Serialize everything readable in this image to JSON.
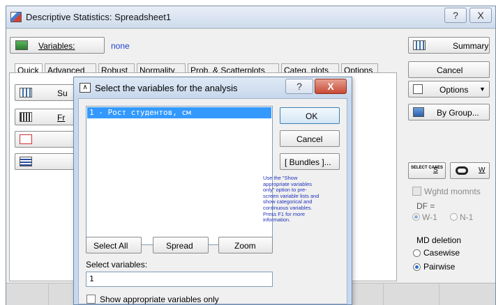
{
  "window": {
    "title": "Descriptive Statistics: Spreadsheet1",
    "help_glyph": "?",
    "close_glyph": "X"
  },
  "variables": {
    "button_label": "Variables:",
    "value": "none"
  },
  "tabs": [
    {
      "label": "Quick"
    },
    {
      "label": "Advanced"
    },
    {
      "label": "Robust"
    },
    {
      "label": "Normality"
    },
    {
      "label": "Prob. & Scatterplots"
    },
    {
      "label": "Categ. plots"
    },
    {
      "label": "Options"
    }
  ],
  "quick_panel": {
    "buttons": [
      {
        "label_partial": "Su"
      },
      {
        "label_partial": "Fr"
      }
    ]
  },
  "right_panel": {
    "summary": "Summary",
    "cancel": "Cancel",
    "options": "Options",
    "by_group": "By Group...",
    "select_cases_icon_text": "SELECT CASES",
    "s_label": "S",
    "w_label": "W",
    "wghtd_momnts": "Wghtd momnts",
    "df_label": "DF =",
    "df_options": [
      "W-1",
      "N-1"
    ],
    "md_deletion_label": "MD deletion",
    "md_options": [
      "Casewise",
      "Pairwise"
    ]
  },
  "dialog": {
    "title": "Select the variables for the analysis",
    "help_glyph": "?",
    "close_glyph": "X",
    "list_items": [
      "1 - Рост студентов, см"
    ],
    "ok": "OK",
    "cancel": "Cancel",
    "bundles": "[ Bundles ]...",
    "hint": "Use the \"Show appropriate variables only\" option to pre-screen variable lists and show categorical and continuous variables. Press F1 for more information.",
    "select_all": "Select All",
    "spread": "Spread",
    "zoom": "Zoom",
    "select_variables_label": "Select variables:",
    "select_variables_value": "1",
    "show_appropriate_label": "Show appropriate variables only"
  }
}
